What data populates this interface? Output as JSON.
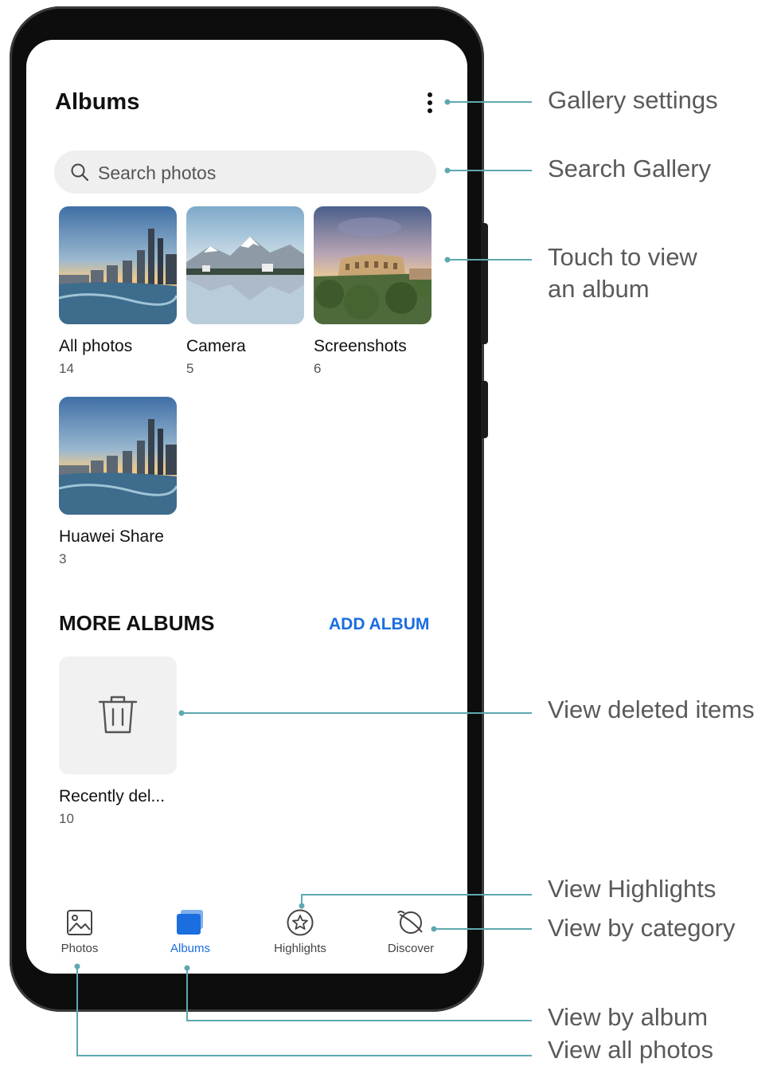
{
  "header": {
    "title": "Albums"
  },
  "search": {
    "placeholder": "Search photos"
  },
  "albums": [
    {
      "name": "All photos",
      "count": "14"
    },
    {
      "name": "Camera",
      "count": "5"
    },
    {
      "name": "Screenshots",
      "count": "6"
    },
    {
      "name": "Huawei Share",
      "count": "3"
    }
  ],
  "more_albums": {
    "title": "MORE ALBUMS",
    "add_label": "ADD ALBUM",
    "items": [
      {
        "name": "Recently del...",
        "count": "10"
      }
    ]
  },
  "tabs": [
    {
      "label": "Photos",
      "icon": "image-icon"
    },
    {
      "label": "Albums",
      "icon": "albums-icon",
      "active": true
    },
    {
      "label": "Highlights",
      "icon": "star-circle-icon"
    },
    {
      "label": "Discover",
      "icon": "planet-icon"
    }
  ],
  "callouts": {
    "gallery_settings": "Gallery settings",
    "search_gallery": "Search Gallery",
    "touch_album_1": "Touch to view",
    "touch_album_2": "an album",
    "view_deleted": "View deleted items",
    "view_highlights": "View Highlights",
    "view_category": "View by category",
    "view_album": "View by album",
    "view_all": "View all photos"
  },
  "colors": {
    "accent": "#1a6ee0",
    "callout_line": "#5fa8b0"
  }
}
